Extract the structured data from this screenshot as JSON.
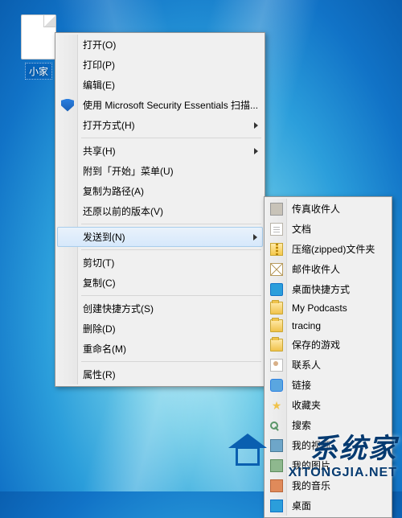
{
  "desktop_icon": {
    "label": "小家"
  },
  "main_menu": {
    "groups": [
      [
        {
          "label": "打开(O)",
          "icon": null
        },
        {
          "label": "打印(P)",
          "icon": null
        },
        {
          "label": "编辑(E)",
          "icon": null
        },
        {
          "label": "使用 Microsoft Security Essentials 扫描...",
          "icon": "shield"
        },
        {
          "label": "打开方式(H)",
          "icon": null,
          "submenu": true
        }
      ],
      [
        {
          "label": "共享(H)",
          "icon": null,
          "submenu": true
        },
        {
          "label": "附到「开始」菜单(U)",
          "icon": null
        },
        {
          "label": "复制为路径(A)",
          "icon": null
        },
        {
          "label": "还原以前的版本(V)",
          "icon": null
        }
      ],
      [
        {
          "label": "发送到(N)",
          "icon": null,
          "submenu": true,
          "highlighted": true
        }
      ],
      [
        {
          "label": "剪切(T)",
          "icon": null
        },
        {
          "label": "复制(C)",
          "icon": null
        }
      ],
      [
        {
          "label": "创建快捷方式(S)",
          "icon": null
        },
        {
          "label": "删除(D)",
          "icon": null
        },
        {
          "label": "重命名(M)",
          "icon": null
        }
      ],
      [
        {
          "label": "属性(R)",
          "icon": null
        }
      ]
    ]
  },
  "sendto_menu": {
    "items": [
      {
        "label": "传真收件人",
        "icon": "fax"
      },
      {
        "label": "文档",
        "icon": "doc"
      },
      {
        "label": "压缩(zipped)文件夹",
        "icon": "zip"
      },
      {
        "label": "邮件收件人",
        "icon": "mail"
      },
      {
        "label": "桌面快捷方式",
        "icon": "desk"
      },
      {
        "label": "My Podcasts",
        "icon": "folder"
      },
      {
        "label": "tracing",
        "icon": "folder"
      },
      {
        "label": "保存的游戏",
        "icon": "folder"
      },
      {
        "label": "联系人",
        "icon": "contact"
      },
      {
        "label": "链接",
        "icon": "link"
      },
      {
        "label": "收藏夹",
        "icon": "star"
      },
      {
        "label": "搜索",
        "icon": "search"
      },
      {
        "label": "我的视频",
        "icon": "video"
      },
      {
        "label": "我的图片",
        "icon": "pict"
      },
      {
        "label": "我的音乐",
        "icon": "music"
      },
      {
        "label": "桌面",
        "icon": "deskf"
      }
    ]
  },
  "watermark": {
    "title": "系统家",
    "url": "XITONGJIA.NET"
  }
}
